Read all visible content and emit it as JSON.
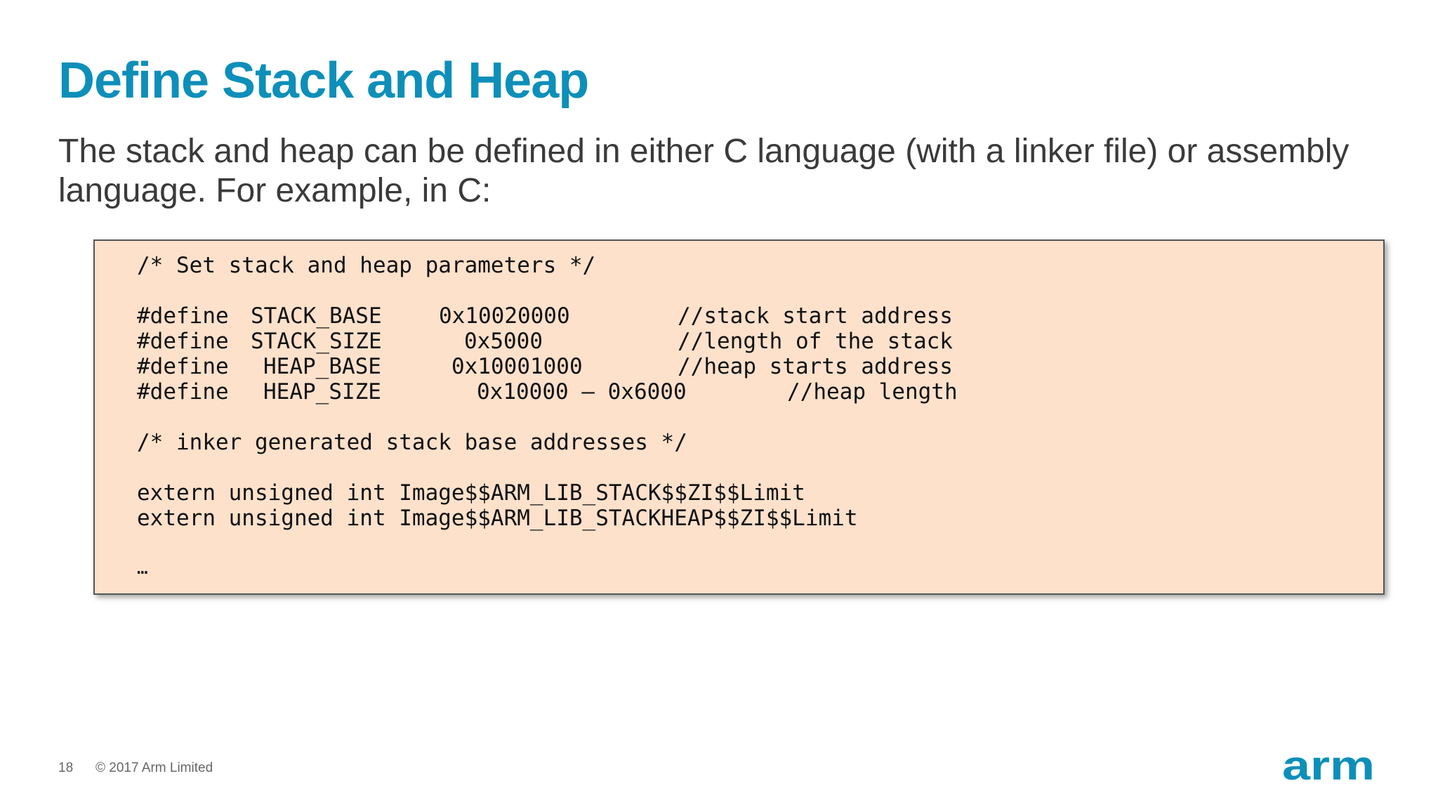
{
  "slide": {
    "title": "Define Stack and Heap",
    "body": "The stack and heap can be defined in either C language (with a linker file) or assembly language. For example, in C:"
  },
  "code": {
    "comment1": "/* Set stack and heap parameters */",
    "defines": [
      {
        "keyword": "#define",
        "name": "STACK_BASE",
        "value": "0x10020000",
        "comment": "//stack start address"
      },
      {
        "keyword": "#define",
        "name": "STACK_SIZE",
        "value": "0x5000",
        "comment": "//length of the stack"
      },
      {
        "keyword": "#define",
        "name": "HEAP_BASE",
        "value": "0x10001000",
        "comment": "//heap starts address"
      },
      {
        "keyword": "#define",
        "name": "HEAP_SIZE",
        "value": "0x10000 – 0x6000",
        "comment": "//heap length"
      }
    ],
    "comment2": "/* inker generated stack base addresses */",
    "extern1": "extern unsigned int Image$$ARM_LIB_STACK$$ZI$$Limit",
    "extern2": "extern unsigned int Image$$ARM_LIB_STACKHEAP$$ZI$$Limit",
    "ellipsis": "…"
  },
  "footer": {
    "page_number": "18",
    "copyright": "© 2017 Arm Limited",
    "logo_text": "arm",
    "logo_color": "#0d8fb9"
  }
}
